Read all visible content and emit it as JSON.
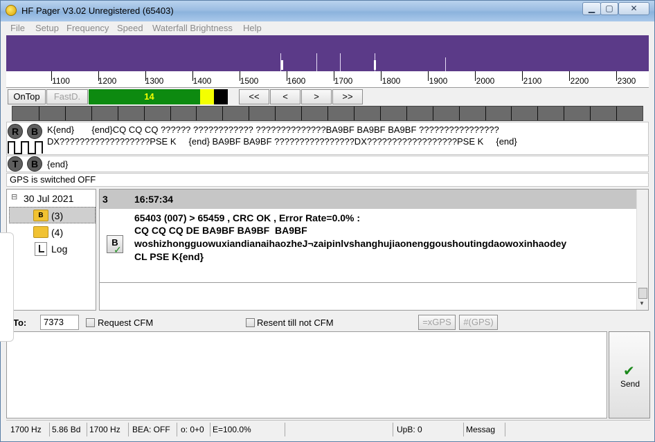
{
  "window": {
    "title": "HF Pager V3.02 Unregistered (65403)"
  },
  "menu": [
    "File",
    "Setup",
    "Frequency",
    "Speed",
    "Waterfall Brightness",
    "Help"
  ],
  "scale": {
    "labels": [
      "1100",
      "1200",
      "1300",
      "1400",
      "1500",
      "1600",
      "1700",
      "1800",
      "1900",
      "2000",
      "2100",
      "2200",
      "2300"
    ]
  },
  "controls": {
    "ontop": "OnTop",
    "fastd": "FastD.",
    "level": "14",
    "level_fraction": 0.8,
    "nav_first": "<<",
    "nav_prev": "<",
    "nav_next": ">",
    "nav_last": ">>"
  },
  "rx": {
    "r_label": "R",
    "b_label": "B",
    "line1": "K{end}       {end}CQ CQ CQ ?????? ???????????? ??????????????BA9BF BA9BF BA9BF ????????????????",
    "line2": "DX??????????????????PSE K     {end} BA9BF BA9BF ????????????????DX??????????????????PSE K     {end}"
  },
  "tx": {
    "t_label": "T",
    "b_label": "B",
    "text": "{end}"
  },
  "gps": {
    "status": "GPS is switched OFF"
  },
  "tree": {
    "date": "30 Jul 2021",
    "expand": "⊟",
    "items": [
      {
        "label": "(3)",
        "badge": "B"
      },
      {
        "label": "(4)"
      },
      {
        "label": "Log"
      }
    ]
  },
  "message": {
    "num": "3",
    "time": "16:57:34",
    "icon_letter": "B",
    "lines": [
      "65403 (007) > 65459 , CRC OK , Error Rate=0.0% :",
      "CQ CQ CQ DE BA9BF BA9BF  BA9BF",
      "woshizhongguowuxiandianaihaozheJ¬zaipinlvshanghujiaonenggoushoutingdaowoxinhaodey",
      "CL PSE K{end}"
    ]
  },
  "to_row": {
    "to_label": "To:",
    "to_value": "7373",
    "request_cfm": "Request CFM",
    "resent": "Resent till not CFM",
    "xgps": "=xGPS",
    "hgps": "#(GPS)"
  },
  "send": {
    "label": "Send"
  },
  "status": {
    "freq1": "1700 Hz",
    "baud": "5.86 Bd",
    "freq2": "1700 Hz",
    "bea": "BEA: OFF",
    "o": "o: 0+0",
    "e": "E=100.0%",
    "upb": "UpB: 0",
    "messag": "Messag"
  }
}
